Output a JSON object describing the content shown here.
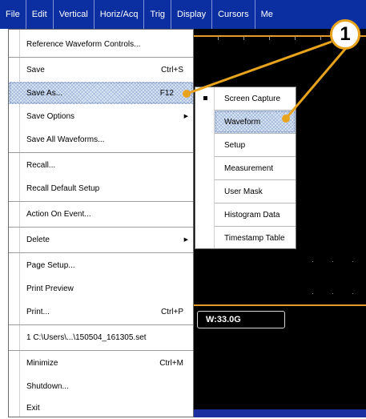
{
  "menubar": {
    "items": [
      "File",
      "Edit",
      "Vertical",
      "Horiz/Acq",
      "Trig",
      "Display",
      "Cursors",
      "Me"
    ]
  },
  "file_menu": {
    "items": [
      {
        "label": "Reference Waveform Controls...",
        "shortcut": "",
        "submenu": false
      },
      {
        "label": "Save",
        "shortcut": "Ctrl+S",
        "submenu": false
      },
      {
        "label": "Save As...",
        "shortcut": "F12",
        "submenu": false,
        "highlighted": true
      },
      {
        "label": "Save Options",
        "shortcut": "",
        "submenu": true
      },
      {
        "label": "Save All Waveforms...",
        "shortcut": "",
        "submenu": false
      },
      {
        "label": "Recall...",
        "shortcut": "",
        "submenu": false
      },
      {
        "label": "Recall Default Setup",
        "shortcut": "",
        "submenu": false
      },
      {
        "label": "Action On Event...",
        "shortcut": "",
        "submenu": false
      },
      {
        "label": "Delete",
        "shortcut": "",
        "submenu": true
      },
      {
        "label": "Page Setup...",
        "shortcut": "",
        "submenu": false
      },
      {
        "label": "Print Preview",
        "shortcut": "",
        "submenu": false
      },
      {
        "label": "Print...",
        "shortcut": "Ctrl+P",
        "submenu": false
      },
      {
        "label": "1 C:\\Users\\...\\150504_161305.set",
        "shortcut": "",
        "submenu": false
      },
      {
        "label": "Minimize",
        "shortcut": "Ctrl+M",
        "submenu": false
      },
      {
        "label": "Shutdown...",
        "shortcut": "",
        "submenu": false
      },
      {
        "label": "Exit",
        "shortcut": "",
        "submenu": false
      }
    ]
  },
  "save_as_submenu": {
    "items": [
      {
        "label": "Screen Capture",
        "selected": true
      },
      {
        "label": "Waveform",
        "highlighted": true
      },
      {
        "label": "Setup"
      },
      {
        "label": "Measurement"
      },
      {
        "label": "User Mask"
      },
      {
        "label": "Histogram Data"
      },
      {
        "label": "Timestamp Table"
      }
    ]
  },
  "scope": {
    "readout": "W:33.0G"
  },
  "callout": {
    "number": "1",
    "color": "#e8a31e"
  },
  "colors": {
    "menubar": "#0b2fa0",
    "highlight_hatch": "#dce7f5",
    "trace_orange": "#e09a28"
  }
}
